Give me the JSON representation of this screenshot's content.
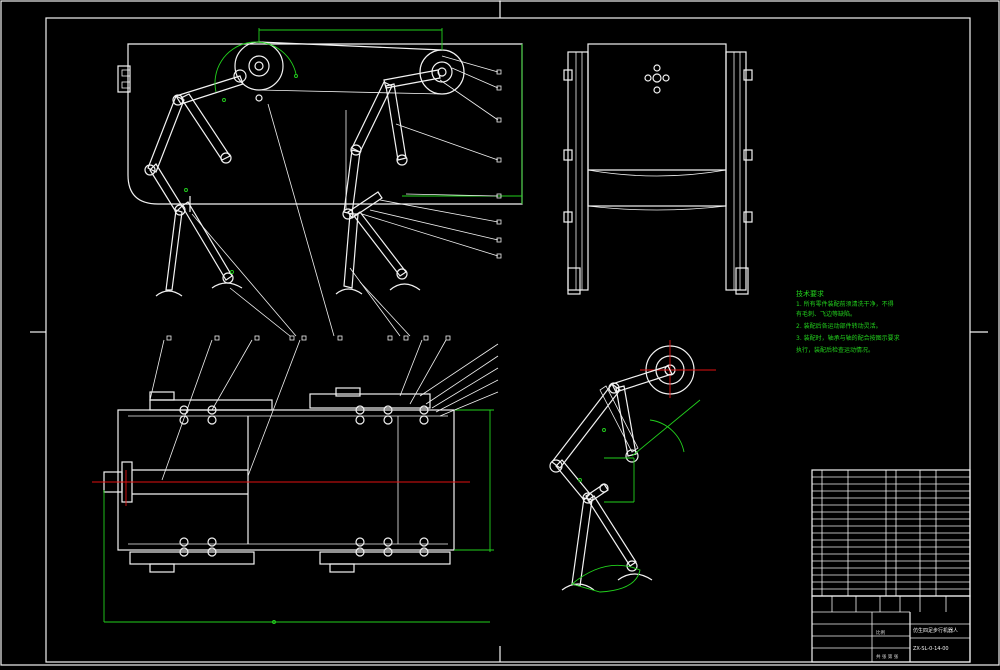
{
  "drawing": {
    "title_block": {
      "drawing_title": "仿生四足步行机器人",
      "drawing_number": "ZX-SL-0-14-00",
      "scale_label": "比例",
      "sheet_label": "共 张 第 张"
    },
    "tech_requirements": {
      "heading": "技术要求",
      "lines": [
        "1. 所有零件装配前须清洗干净，不得",
        "有毛刺、飞边等缺陷。",
        "2. 装配后各运动部件转动灵活。",
        "3. 装配时，轴承与轴的配合按图示要求",
        "执行，装配后检查运动情况。"
      ]
    }
  }
}
